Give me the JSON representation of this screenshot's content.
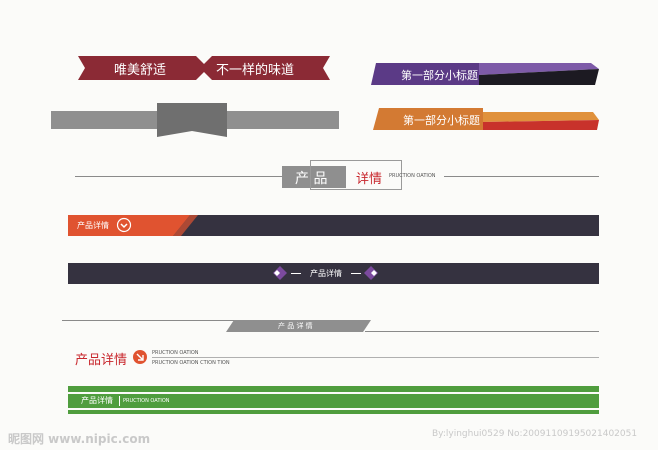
{
  "colors": {
    "maroon": "#8b2a35",
    "purple": "#5b3a86",
    "orange": "#d37a33",
    "red_orange": "#e05330",
    "dark": "#353240",
    "gray": "#8f8f8f",
    "green": "#4f9d3e",
    "title_red": "#c8272d"
  },
  "ribbon_maroon": {
    "left": "唯美舒适",
    "right": "不一样的味道"
  },
  "tag_purple": {
    "label": "第一部分小标题"
  },
  "tag_orange": {
    "label": "第一部分小标题"
  },
  "banner_product": {
    "box_left": "产 品",
    "box_right": "详情",
    "sub": "PRUCTION OATION"
  },
  "bar_orange": {
    "label": "产品详情",
    "icon": "chevron-down-circle-icon"
  },
  "bar_dark": {
    "label": "产品详情",
    "icon": "diamond-icon"
  },
  "bar_gray": {
    "label": "产 品 详 情"
  },
  "title_red": {
    "label": "产品详情",
    "icon": "arrow-down-right-circle-icon",
    "sub1": "PRUCTION OATION",
    "sub2": "PRUCTION OATION CTION TION"
  },
  "bar_green": {
    "label": "产品详情",
    "sub": "PRUCTION OATION"
  },
  "watermark": {
    "left": "昵图网 www.nipic.com",
    "right": "By:lyinghui0529 No:20091109195021402051"
  }
}
